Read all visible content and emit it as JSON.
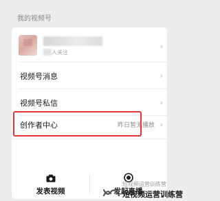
{
  "section": {
    "title": "我的视频号"
  },
  "profile": {
    "follow_text": "人关注"
  },
  "menu": {
    "items": [
      {
        "label": "视频号消息",
        "value": ""
      },
      {
        "label": "视频号私信",
        "value": ""
      },
      {
        "label": "创作者中心",
        "value": "昨日暂无播放"
      }
    ]
  },
  "actions": {
    "post_video": {
      "label": "发表视频",
      "icon": "camera-icon"
    },
    "start_live": {
      "label": "发起直播",
      "icon": "live-record-icon"
    }
  },
  "watermark": {
    "top_text": "短视频运营训练营",
    "main_text": "短视频运营训练营"
  },
  "colors": {
    "highlight": "#e53233",
    "background": "#ededed",
    "card": "#ffffff"
  }
}
